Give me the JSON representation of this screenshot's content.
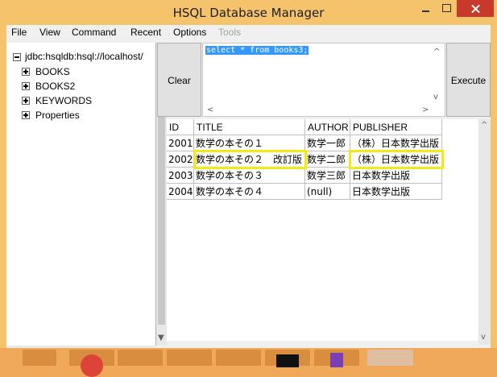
{
  "window": {
    "title": "HSQL Database Manager"
  },
  "menubar": {
    "items": [
      {
        "label": "File",
        "enabled": true
      },
      {
        "label": "View",
        "enabled": true
      },
      {
        "label": "Command",
        "enabled": true
      },
      {
        "label": "Recent",
        "enabled": true
      },
      {
        "label": "Options",
        "enabled": true
      },
      {
        "label": "Tools",
        "enabled": false
      }
    ]
  },
  "tree": {
    "root": "jdbc:hsqldb:hsql://localhost/",
    "items": [
      "BOOKS",
      "BOOKS2",
      "KEYWORDS",
      "Properties"
    ]
  },
  "query": {
    "clear_label": "Clear",
    "execute_label": "Execute",
    "sql": "select * from books3;"
  },
  "results": {
    "columns": [
      "ID",
      "TITLE",
      "AUTHOR",
      "PUBLISHER"
    ],
    "rows": [
      [
        "2001",
        "数学の本その１",
        "数学一郎",
        "（株）日本数学出版"
      ],
      [
        "2002",
        "数学の本その２　改訂版",
        "数学二郎",
        "（株）日本数学出版"
      ],
      [
        "2003",
        "数学の本その３",
        "数学三郎",
        "日本数学出版"
      ],
      [
        "2004",
        "数学の本その４",
        "(null)",
        "日本数学出版"
      ]
    ],
    "highlight_color": "#f2ea17"
  },
  "taskbar": {
    "items": [
      "file-explorer-icon",
      "chrome-icon",
      "pen-tool-icon",
      "notepad-icon",
      "paint-icon",
      "command-prompt-icon",
      "visual-studio-icon",
      "java-app-icon"
    ]
  }
}
